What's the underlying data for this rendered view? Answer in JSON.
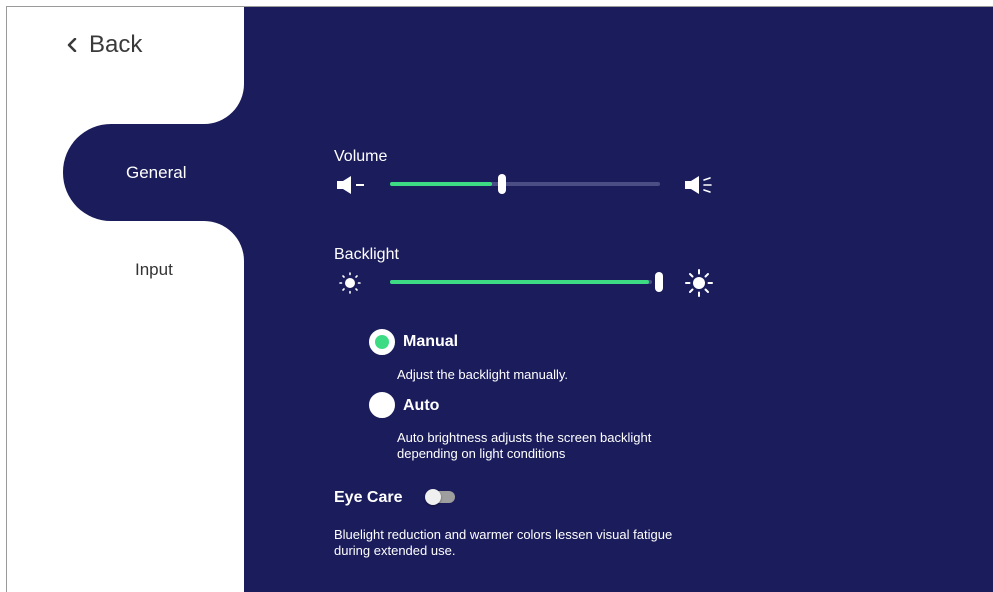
{
  "nav": {
    "back_label": "Back",
    "tabs": [
      {
        "label": "General",
        "selected": true
      },
      {
        "label": "Input",
        "selected": false
      }
    ]
  },
  "volume": {
    "label": "Volume",
    "level_fraction": 0.42,
    "icons": [
      "volume-down-icon",
      "volume-up-icon"
    ]
  },
  "backlight": {
    "label": "Backlight",
    "level_fraction": 1.0,
    "icons": [
      "brightness-low-icon",
      "brightness-high-icon"
    ],
    "modes": [
      {
        "label": "Manual",
        "description": "Adjust the backlight manually.",
        "selected": true
      },
      {
        "label": "Auto",
        "description_line1": "Auto brightness adjusts the screen backlight",
        "description_line2": "depending on light conditions",
        "selected": false
      }
    ]
  },
  "eye_care": {
    "label": "Eye Care",
    "enabled": false,
    "description_line1": "Bluelight reduction and warmer colors lessen visual fatigue",
    "description_line2": "during extended use."
  },
  "colors": {
    "panel": "#1b1c5c",
    "accent": "#3ddc84",
    "track": "#4b4d85"
  }
}
